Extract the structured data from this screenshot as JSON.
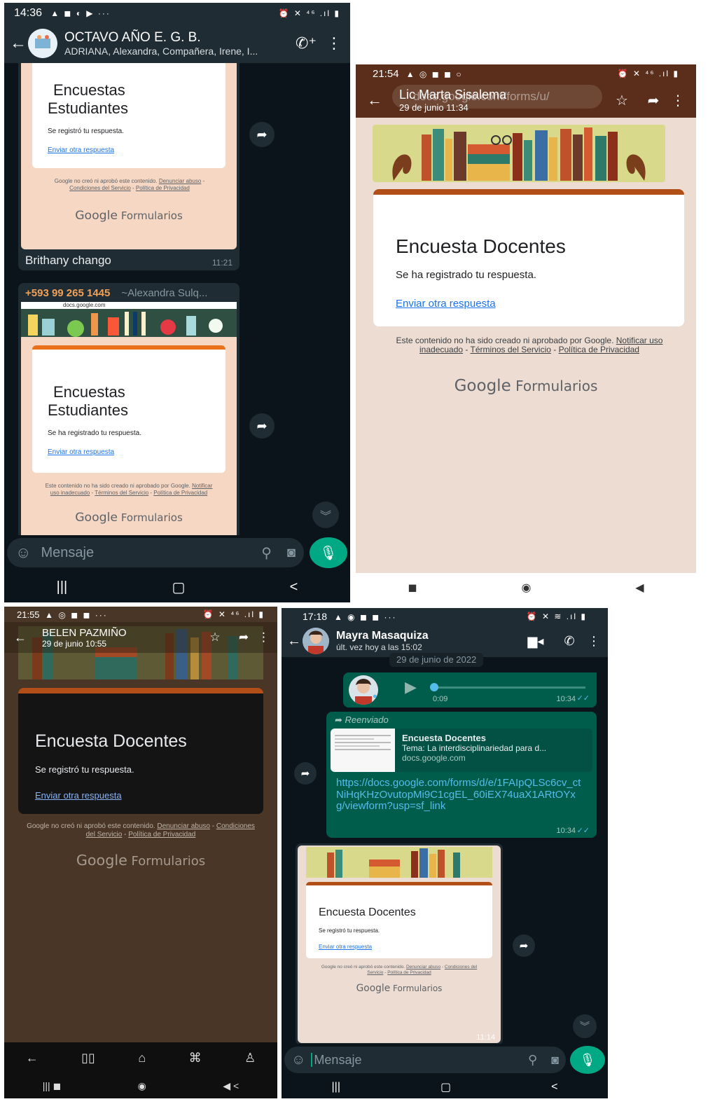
{
  "s1": {
    "status_time": "14:36",
    "status_icons": "▲ ◼ ◐ ▶ ···",
    "status_right": "⏰ ✕ ⁴⁶ .ıl ▮",
    "chat_title": "OCTAVO AÑO E. G. B.",
    "chat_subtitle": "ADRIANA, Alexandra, Compañera, Irene, I...",
    "card1": {
      "title_line1": "Encuestas",
      "title_line2": "Estudiantes",
      "response": "Se registró tu respuesta.",
      "link": "Enviar otra respuesta",
      "footer_pre": "Google no creó ni aprobó este contenido.",
      "footer_link1": "Denunciar abuso",
      "footer_link2": "Condiciones del Servicio",
      "footer_link3": "Política de Privacidad",
      "brand_a": "Google",
      "brand_b": "Formularios"
    },
    "caption1": "Brithany chango",
    "caption1_time": "11:21",
    "msg2_sender": "+593 99 265 1445",
    "msg2_name": "~Alexandra Sulq...",
    "msg2_url": "docs.google.com",
    "card2": {
      "title_line1": "Encuestas",
      "title_line2": "Estudiantes",
      "response": "Se ha registrado tu respuesta.",
      "link": "Enviar otra respuesta",
      "footer_pre": "Este contenido no ha sido creado ni aprobado por Google.",
      "footer_link1": "Notificar uso inadecuado",
      "footer_link2": "Términos del Servicio",
      "footer_link3": "Política de Privacidad",
      "brand_a": "Google",
      "brand_b": "Formularios"
    },
    "input_placeholder": "Mensaje"
  },
  "s2": {
    "status_time": "21:54",
    "status_icons": "▲ ◎ ◼ ◼ ○",
    "status_right": "⏰ ✕ ⁴⁶ .ıl ▮",
    "header_name": "Lic Marta Sisalema",
    "header_date": "29 de junio 11:34",
    "header_url": "docs.google.com/forms/u/",
    "title": "Encuesta Docentes",
    "response": "Se ha registrado tu respuesta.",
    "link": "Enviar otra respuesta",
    "footer_pre": "Este contenido no ha sido creado ni aprobado por Google.",
    "footer_link1": "Notificar uso inadecuado",
    "footer_link2": "Términos del Servicio",
    "footer_link3": "Política de Privacidad",
    "brand_a": "Google",
    "brand_b": "Formularios"
  },
  "s3": {
    "status_time": "21:55",
    "status_icons": "▲ ◎ ◼ ◼ ···",
    "status_right": "⏰ ✕ ⁴⁶ .ıl ▮",
    "header_name": "BELEN PAZMIÑO",
    "header_date": "29 de junio 10:55",
    "title": "Encuesta Docentes",
    "response": "Se registró tu respuesta.",
    "link": "Enviar otra respuesta",
    "footer_pre": "Google no creó ni aprobó este contenido.",
    "footer_link1": "Denunciar abuso",
    "footer_link2": "Condiciones del Servicio",
    "footer_link3": "Política de Privacidad",
    "brand_a": "Google",
    "brand_b": "Formularios"
  },
  "s4": {
    "status_time": "17:18",
    "status_icons": "▲ ◉ ◼ ◼ ···",
    "status_right": "⏰ ✕ ≋ .ıl ▮",
    "contact_name": "Mayra Masaquiza",
    "last_seen": "últ. vez hoy a las 15:02",
    "date_chip": "29 de junio de 2022",
    "voice_duration": "0:09",
    "voice_time": "10:34",
    "forwarded": "Reenviado",
    "preview_title": "Encuesta Docentes",
    "preview_desc": "Tema: La interdisciplinariedad para d...",
    "preview_domain": "docs.google.com",
    "link_text": "https://docs.google.com/forms/d/e/1FAIpQLSc6cv_ctNiHqKHzOvutopMi9C1cgEL_60iEX74uaX1ARtOYxg/viewform?usp=sf_link",
    "link_time": "10:34",
    "card": {
      "title": "Encuesta Docentes",
      "response": "Se registró tu respuesta.",
      "link": "Enviar otra respuesta",
      "footer_pre": "Google no creó ni aprobó este contenido.",
      "footer_link1": "Denunciar abuso",
      "footer_link2": "Condiciones del Servicio",
      "footer_link3": "Política de Privacidad",
      "brand_a": "Google",
      "brand_b": "Formularios"
    },
    "image_time": "11:14",
    "input_placeholder": "Mensaje"
  }
}
